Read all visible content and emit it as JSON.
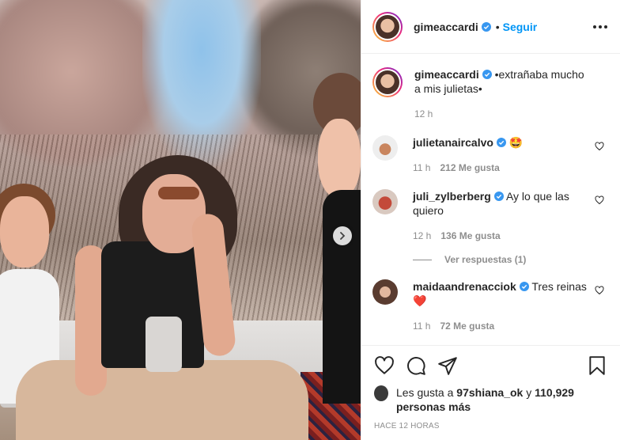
{
  "post": {
    "author": "gimeaccardi",
    "follow_label": "Seguir",
    "separator": "•",
    "caption": "•extrañaba mucho a mis julietas•",
    "caption_time": "12 h"
  },
  "comments": [
    {
      "username": "julietanaircalvo",
      "text": "🤩",
      "time": "11 h",
      "likes": "212 Me gusta"
    },
    {
      "username": "juli_zylberberg",
      "text": "Ay lo que las quiero",
      "time": "12 h",
      "likes": "136 Me gusta"
    },
    {
      "username": "maidaandrenacciok",
      "text": "Tres reinas ❤️",
      "time": "11 h",
      "likes": "72 Me gusta"
    }
  ],
  "view_replies_label": "Ver respuestas (1)",
  "likes": {
    "prefix": "Les gusta a",
    "user": "97shiana_ok",
    "conj": "y",
    "count": "110,929 personas más"
  },
  "timestamp": "HACE 12 HORAS",
  "colors": {
    "accent": "#0095f6",
    "verified": "#3897f0",
    "text": "#262626",
    "muted": "#8e8e8e"
  },
  "icons": [
    "next-arrow-icon",
    "verified-icon",
    "more-icon",
    "heart-icon",
    "comment-icon",
    "share-icon",
    "bookmark-icon"
  ]
}
